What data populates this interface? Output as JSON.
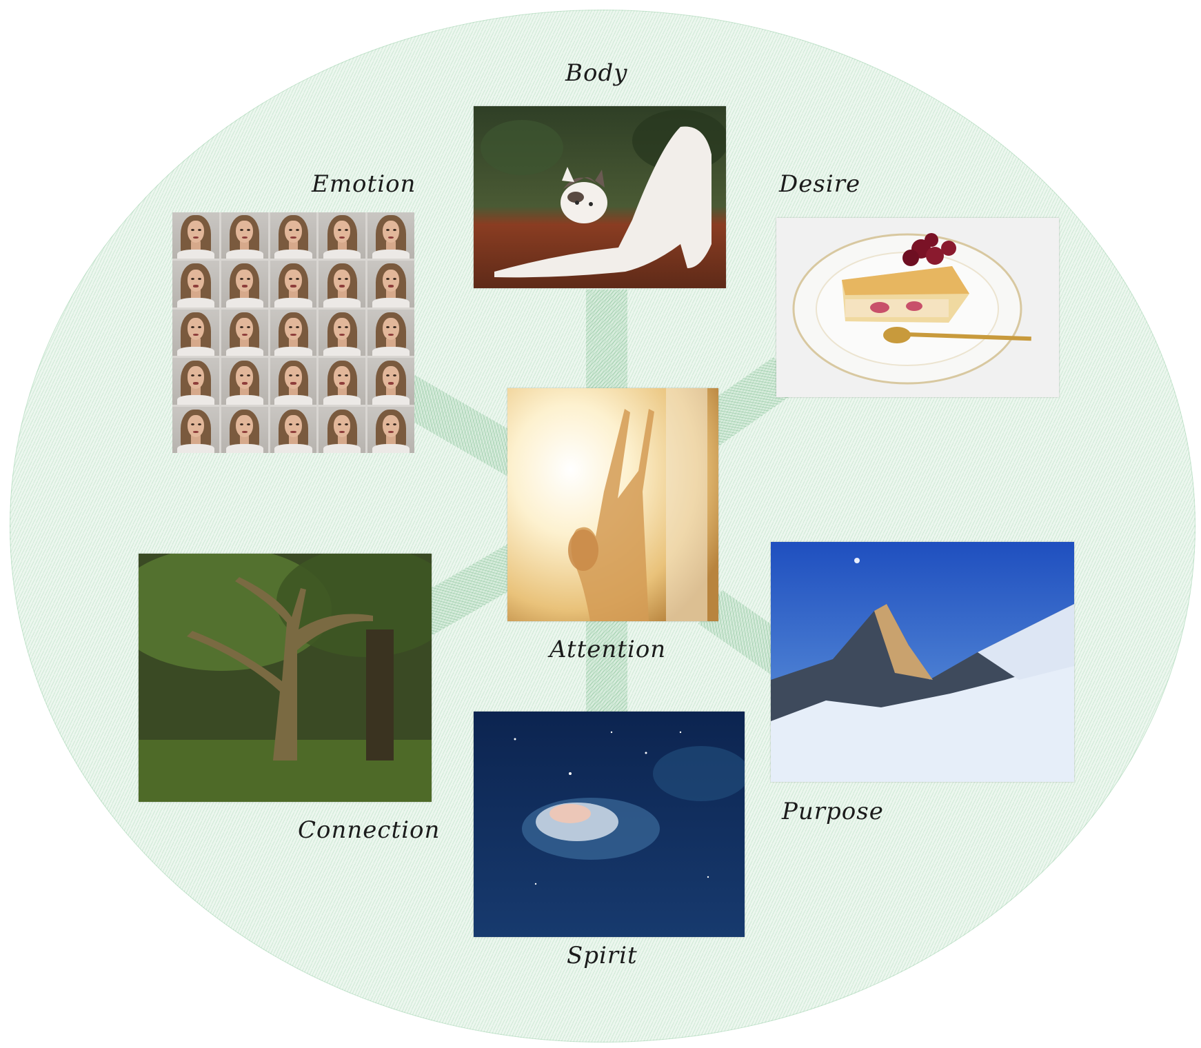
{
  "labels": {
    "body": "Body",
    "emotion": "Emotion",
    "desire": "Desire",
    "attention": "Attention",
    "connection": "Connection",
    "spirit": "Spirit",
    "purpose": "Purpose"
  },
  "colors": {
    "hatch_green": "#82c496",
    "background": "#ffffff",
    "label_text": "#1b1b1b"
  },
  "images": {
    "body": "cat-stretching-photo",
    "emotion": "grid-of-facial-expressions-photo",
    "desire": "cherry-cake-slice-photo",
    "attention": "woman-in-sunlight-photo",
    "connection": "forest-tree-photo",
    "spirit": "night-sky-cloud-photo",
    "purpose": "mountain-peak-photo"
  }
}
